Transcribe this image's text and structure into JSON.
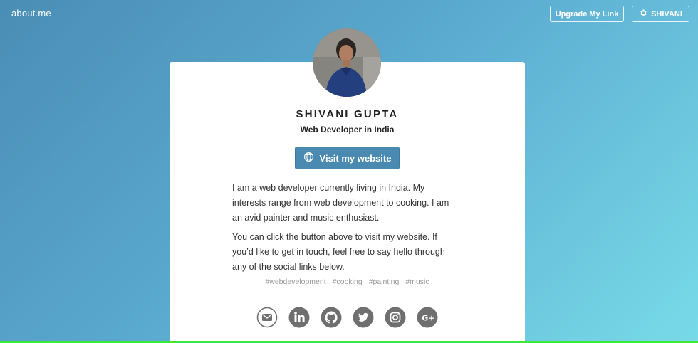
{
  "header": {
    "logo": "about.me",
    "upgrade_label": "Upgrade My Link",
    "user_label": "SHIVANI"
  },
  "profile": {
    "name": "SHIVANI GUPTA",
    "headline": "Web Developer in India",
    "cta_label": "Visit my website",
    "bio": [
      "I am a web developer currently living in India. My interests range from web development to cooking. I am an avid painter and music enthusiast.",
      "You can click the button above to visit my website. If you’d like to get in touch, feel free to say hello through any of the social links below."
    ],
    "tags": [
      "#webdevelopment",
      "#cooking",
      "#painting",
      "#music"
    ],
    "socials": [
      "email-icon",
      "linkedin-icon",
      "github-icon",
      "twitter-icon",
      "instagram-icon",
      "google-plus-icon"
    ]
  },
  "colors": {
    "accent": "#4a89b0",
    "social_icon": "#6f6f6f",
    "bottom_bar": "#3ee83a"
  }
}
